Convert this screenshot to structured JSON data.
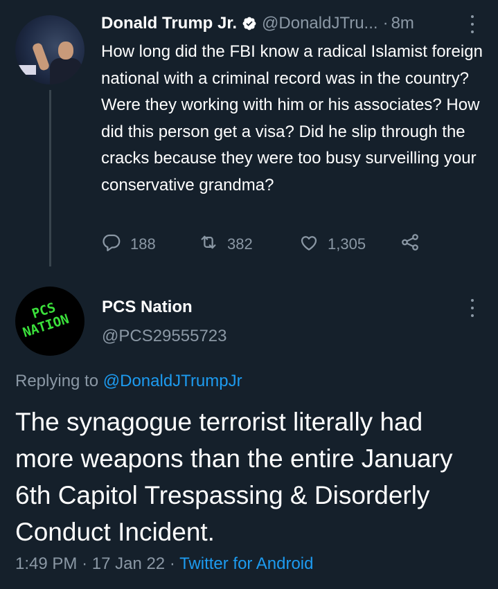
{
  "tweet1": {
    "display_name": "Donald Trump Jr.",
    "handle": "@DonaldJTru...",
    "separator": "·",
    "time": "8m",
    "text": "How long did the FBI know a radical Islamist foreign national with a criminal record was in the country? Were they working with him or his associates? How did this person get a visa? Did he slip through the cracks because they were too busy surveilling your conservative grandma?",
    "replies": "188",
    "retweets": "382",
    "likes": "1,305"
  },
  "tweet2": {
    "display_name": "PCS Nation",
    "handle": "@PCS29555723",
    "avatar_text_top": "PCS",
    "avatar_text_bottom": "NATION",
    "replying_prefix": "Replying to",
    "replying_to": "@DonaldJTrumpJr",
    "text": "The synagogue terrorist literally had more weapons than the entire January 6th Capitol Trespassing & Disorderly Conduct Incident.",
    "time": "1:49 PM",
    "sep1": "·",
    "date": "17 Jan 22",
    "sep2": "·",
    "source": "Twitter for Android"
  },
  "icons": {
    "verified": "verified-badge-icon",
    "reply": "reply-icon",
    "retweet": "retweet-icon",
    "like": "heart-icon",
    "share": "share-icon",
    "more": "more-vertical-icon"
  },
  "colors": {
    "background": "#15202b",
    "text": "#ffffff",
    "secondary": "#8b98a5",
    "link": "#1d9bf0",
    "thread_line": "#38444d"
  }
}
